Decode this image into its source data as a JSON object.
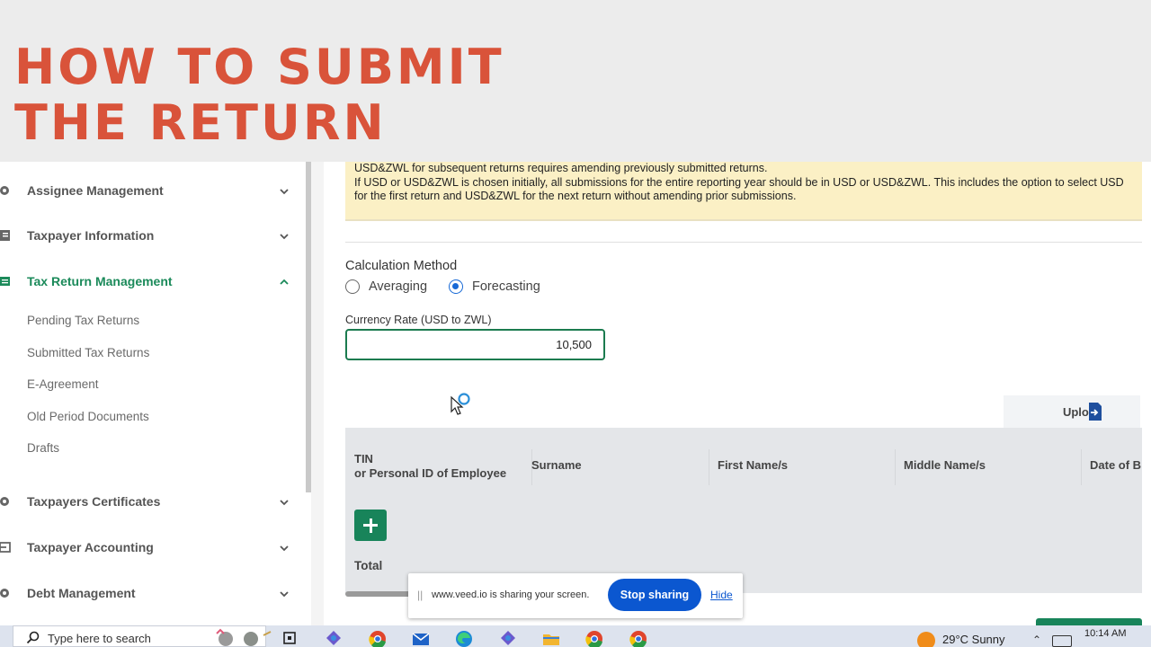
{
  "banner": {
    "title": "HOW TO SUBMIT\nTHE RETURN"
  },
  "sidebar": {
    "items": [
      {
        "label": "Assignee Management",
        "icon": "gear-icon"
      },
      {
        "label": "Taxpayer Information",
        "icon": "document-icon"
      },
      {
        "label": "Tax Return Management",
        "icon": "list-icon",
        "active": true
      },
      {
        "label": "Taxpayers Certificates",
        "icon": "gear-icon"
      },
      {
        "label": "Taxpayer Accounting",
        "icon": "login-icon"
      },
      {
        "label": "Debt Management",
        "icon": "gear-icon"
      }
    ],
    "sub_items": [
      "Pending Tax Returns",
      "Submitted Tax Returns",
      "E-Agreement",
      "Old Period Documents",
      "Drafts"
    ]
  },
  "notice": {
    "line1": "USD&ZWL for subsequent returns requires amending previously submitted returns.",
    "line2": "If USD or USD&ZWL is chosen initially, all submissions for the entire reporting year should be in USD or USD&ZWL. This includes the option to select USD for the first return and USD&ZWL for the next return without amending prior submissions."
  },
  "calculation": {
    "label": "Calculation Method",
    "options": [
      "Averaging",
      "Forecasting"
    ],
    "selected": "Forecasting"
  },
  "currency": {
    "label": "Currency Rate (USD to ZWL)",
    "value": "10,500"
  },
  "upload": {
    "label": "Upload"
  },
  "table": {
    "headers": [
      "TIN\nor Personal ID of Employee",
      "Surname",
      "First Name/s",
      "Middle Name/s",
      "Date of B"
    ],
    "total_label": "Total"
  },
  "share_bar": {
    "grip": "||",
    "text": "www.veed.io is sharing your screen.",
    "stop_label": "Stop sharing",
    "hide_label": "Hide"
  },
  "taskbar": {
    "search_placeholder": "Type here to search",
    "weather": "29°C  Sunny",
    "time": "10:14 AM"
  },
  "colors": {
    "accent_green": "#1b8a5a",
    "title_red": "#d9533a",
    "notice_yellow": "#fbf0c5",
    "chrome_blue": "#0b57d0"
  }
}
